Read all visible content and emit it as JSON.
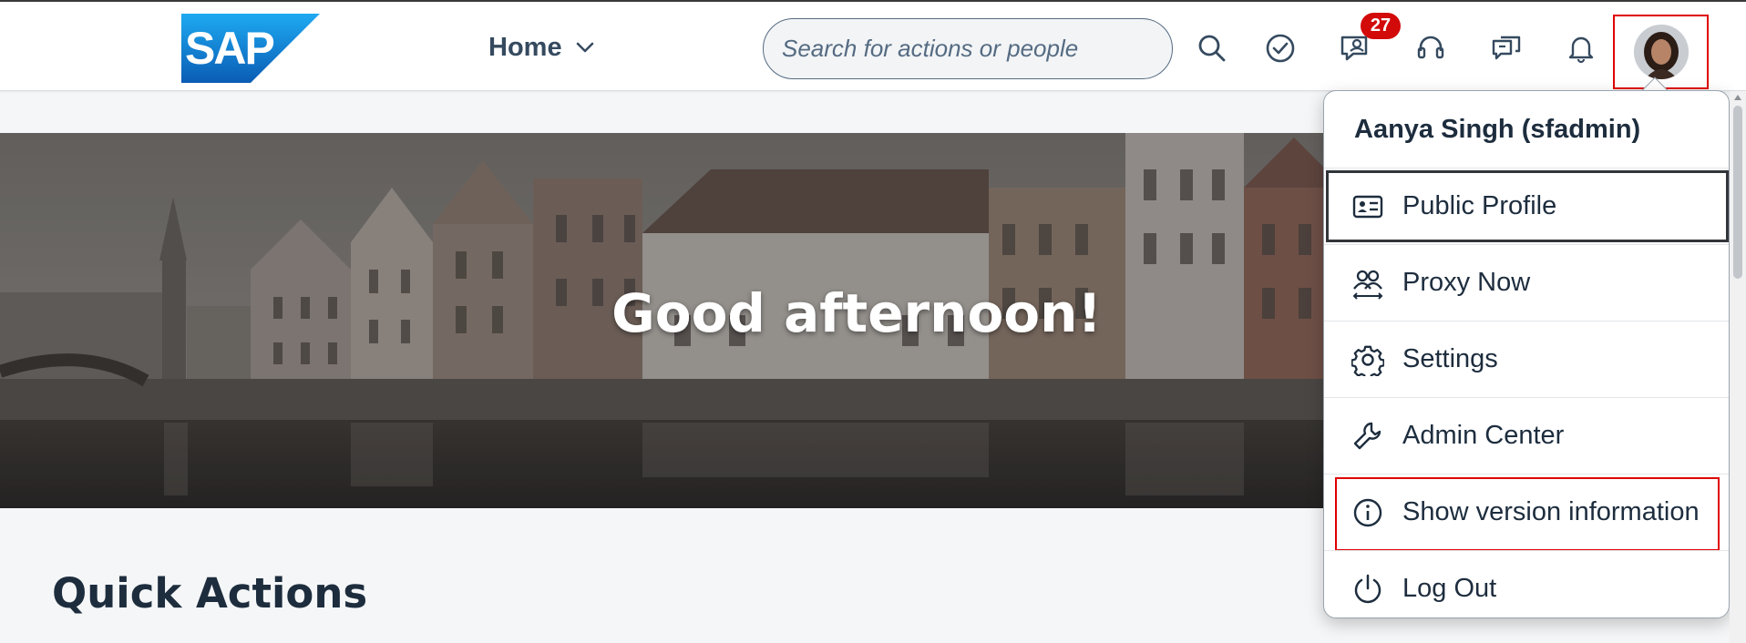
{
  "header": {
    "logo_text": "SAP",
    "home_label": "Home",
    "search_placeholder": "Search for actions or people",
    "tasks_badge": "27",
    "icons": [
      "search-icon",
      "tasks-icon",
      "assistant-icon",
      "support-icon",
      "feedback-icon",
      "notifications-icon"
    ]
  },
  "hero": {
    "greeting": "Good afternoon!"
  },
  "section": {
    "title": "Quick Actions"
  },
  "profile_menu": {
    "user_name": "Aanya Singh (sfadmin)",
    "items": [
      {
        "label": "Public Profile",
        "icon": "id-card-icon"
      },
      {
        "label": "Proxy Now",
        "icon": "proxy-icon"
      },
      {
        "label": "Settings",
        "icon": "gear-icon"
      },
      {
        "label": "Admin Center",
        "icon": "wrench-icon"
      },
      {
        "label": "Show version information",
        "icon": "info-icon"
      },
      {
        "label": "Log Out",
        "icon": "power-icon"
      }
    ]
  },
  "colors": {
    "brand_blue": "#0a6ed1",
    "badge_red": "#d20a0a",
    "highlight_red": "#e00000",
    "text_dark": "#1d2d3e"
  }
}
